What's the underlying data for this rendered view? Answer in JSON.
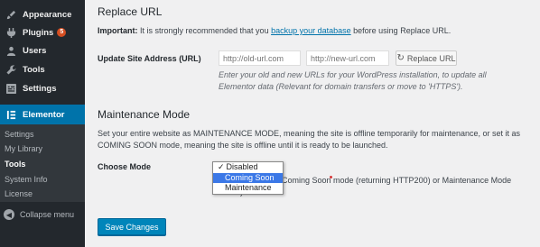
{
  "sidebar": {
    "items": [
      {
        "label": "Appearance",
        "icon": "brush-icon"
      },
      {
        "label": "Plugins",
        "icon": "plugin-icon",
        "badge": "5"
      },
      {
        "label": "Users",
        "icon": "users-icon"
      },
      {
        "label": "Tools",
        "icon": "wrench-icon"
      },
      {
        "label": "Settings",
        "icon": "settings-icon"
      },
      {
        "label": "Elementor",
        "icon": "elementor-icon"
      }
    ],
    "submenu": [
      "Settings",
      "My Library",
      "Tools",
      "System Info",
      "License"
    ],
    "current_submenu": "Tools",
    "collapse_label": "Collapse menu"
  },
  "replace_url": {
    "title": "Replace URL",
    "important_label": "Important:",
    "important_before": " It is strongly recommended that you ",
    "important_link": "backup your database",
    "important_after": " before using Replace URL.",
    "field_label": "Update Site Address (URL)",
    "old_placeholder": "http://old-url.com",
    "new_placeholder": "http://new-url.com",
    "button_label": "Replace URL",
    "hint": "Enter your old and new URLs for your WordPress installation, to update all Elementor data (Relevant for domain transfers or move to 'HTTPS')."
  },
  "maintenance": {
    "title": "Maintenance Mode",
    "description": "Set your entire website as MAINTENANCE MODE, meaning the site is offline temporarily for maintenance, or set it as COMING SOON mode, meaning the site is offline until it is ready to be launched.",
    "choose_label": "Choose Mode",
    "options": [
      "Disabled",
      "Coming Soon",
      "Maintenance"
    ],
    "checked_option": "Disabled",
    "highlighted_option": "Coming Soon",
    "mode_text_line1": "Coming Soon mode (returning HTTP200) or Maintenance Mode",
    "mode_text_line2": "03)."
  },
  "save_label": "Save Changes"
}
